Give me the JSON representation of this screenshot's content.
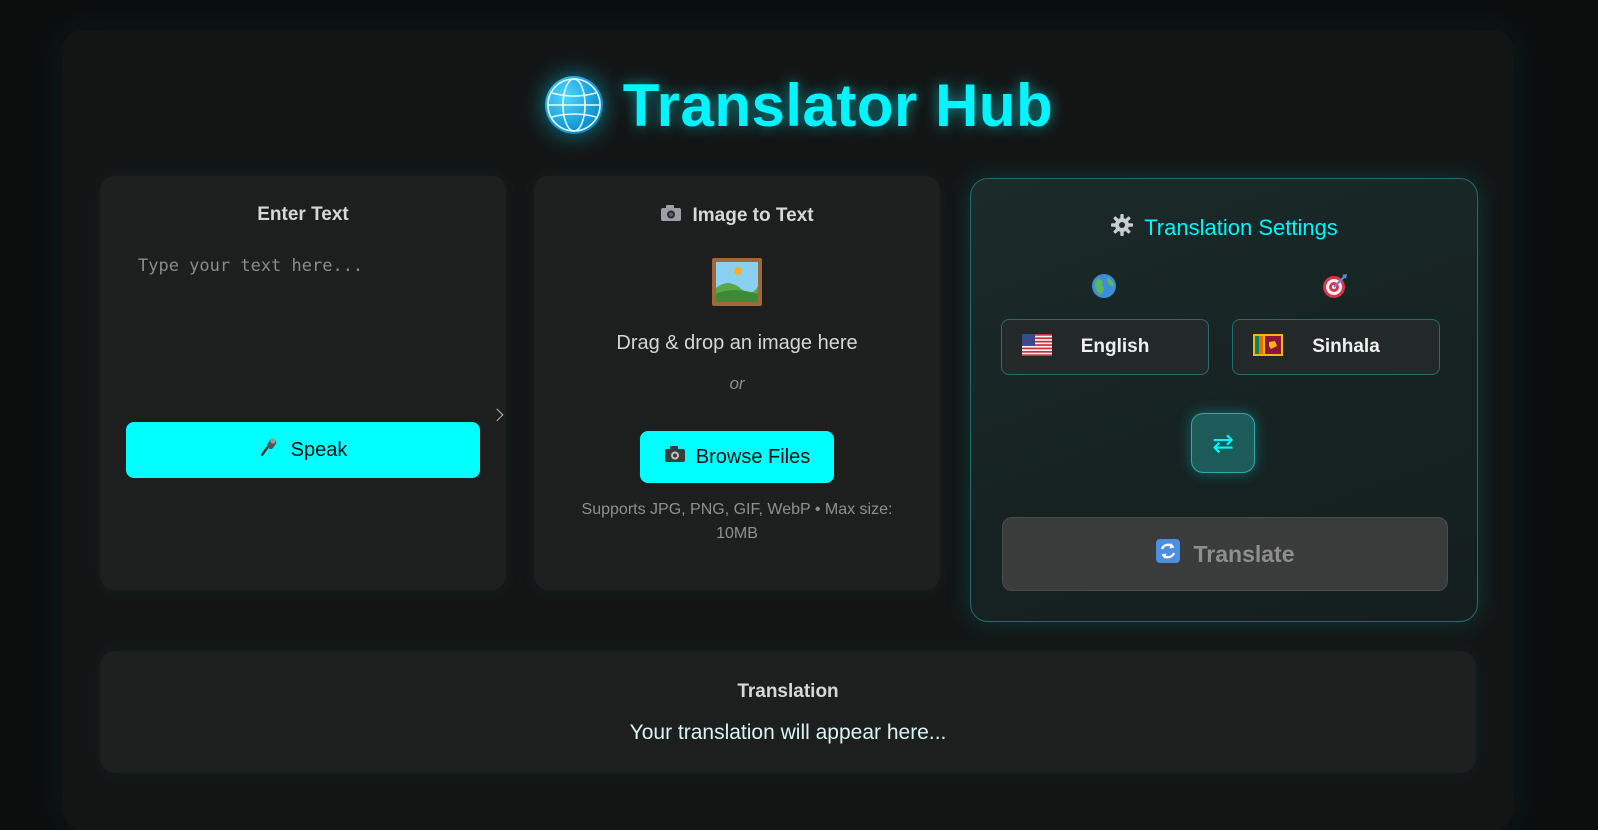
{
  "app": {
    "title": "Translator Hub",
    "icon": "globe-icon",
    "accent_color": "#00f5ff"
  },
  "text_input": {
    "title": "Enter Text",
    "placeholder": "Type your text here...",
    "value": "",
    "speak_button": {
      "icon": "microphone-icon",
      "label": "Speak"
    }
  },
  "image_input": {
    "title": "Image to Text",
    "title_icon": "camera-icon",
    "drop_icon": "framed-picture-icon",
    "drop_text": "Drag & drop an image here",
    "or_text": "or",
    "browse_button": {
      "icon": "camera-icon",
      "label": "Browse Files"
    },
    "supports_text": "Supports JPG, PNG, GIF, WebP • Max size: 10MB"
  },
  "settings": {
    "title": "Translation Settings",
    "title_icon": "gear-icon",
    "source": {
      "icon": "globe-icon",
      "flag": "us-flag-icon",
      "language": "English"
    },
    "target": {
      "icon": "target-icon",
      "flag": "sri-lanka-flag-icon",
      "language": "Sinhala"
    },
    "swap_button": {
      "icon": "swap-arrows-icon",
      "glyph": "⇄"
    },
    "translate_button": {
      "icon": "refresh-icon",
      "label": "Translate",
      "disabled": true
    }
  },
  "output": {
    "title": "Translation",
    "placeholder_text": "Your translation will appear here..."
  }
}
